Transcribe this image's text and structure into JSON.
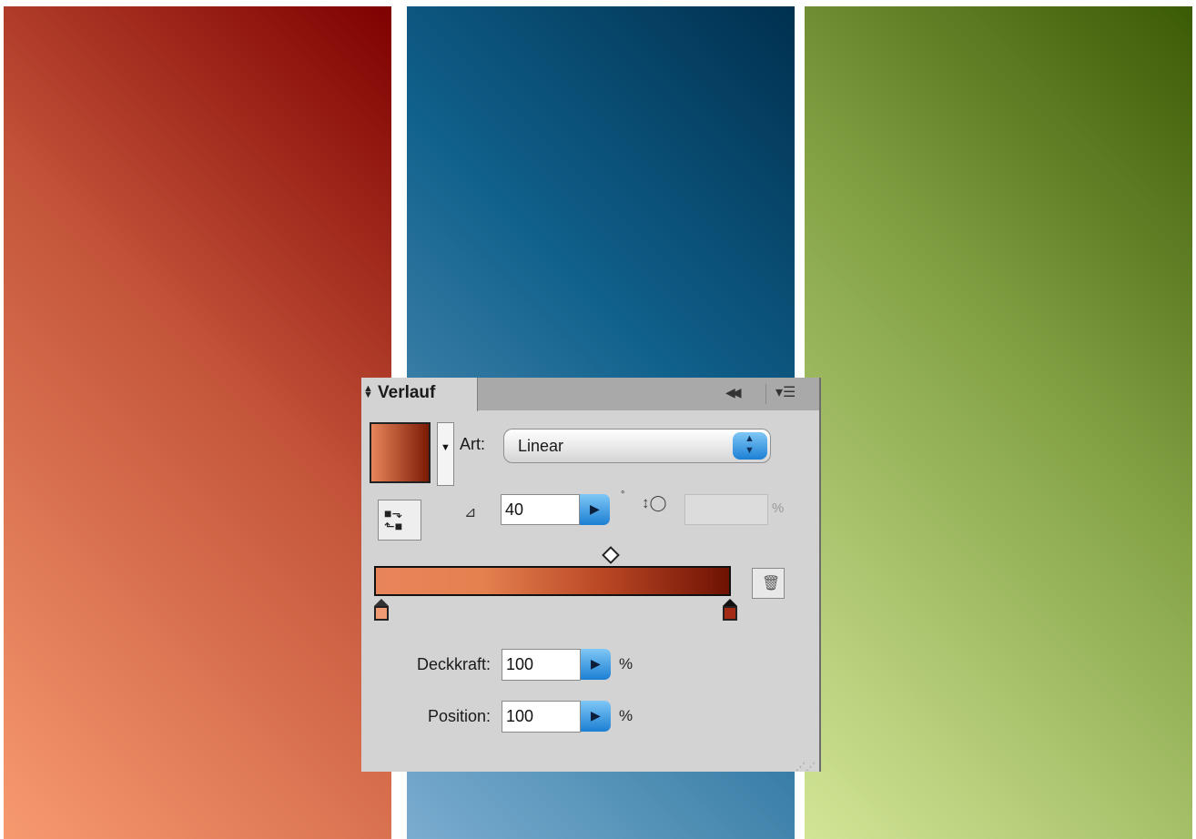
{
  "panel": {
    "title": "Verlauf",
    "type_label": "Art:",
    "type_value": "Linear",
    "angle_value": "40",
    "angle_unit": "°",
    "aspect_value": "",
    "aspect_unit": "%",
    "opacity_label": "Deckkraft:",
    "opacity_value": "100",
    "opacity_unit": "%",
    "position_label": "Position:",
    "position_value": "100",
    "position_unit": "%"
  },
  "gradient": {
    "start_color": "#e8845a",
    "end_color": "#6f1203",
    "stops": [
      {
        "color": "#f19b74",
        "location": 0
      },
      {
        "color": "#a32a14",
        "location": 100
      }
    ]
  },
  "swatches": [
    {
      "name": "red",
      "from": "#f79a70",
      "to": "#7e0000"
    },
    {
      "name": "blue",
      "from": "#7badd0",
      "to": "#00304f"
    },
    {
      "name": "green",
      "from": "#d2e597",
      "to": "#3b5a04"
    }
  ],
  "icons": [
    "collapse-icon",
    "panel-menu-icon",
    "reverse-gradient-icon",
    "angle-icon",
    "aspect-ratio-icon",
    "trash-icon"
  ]
}
